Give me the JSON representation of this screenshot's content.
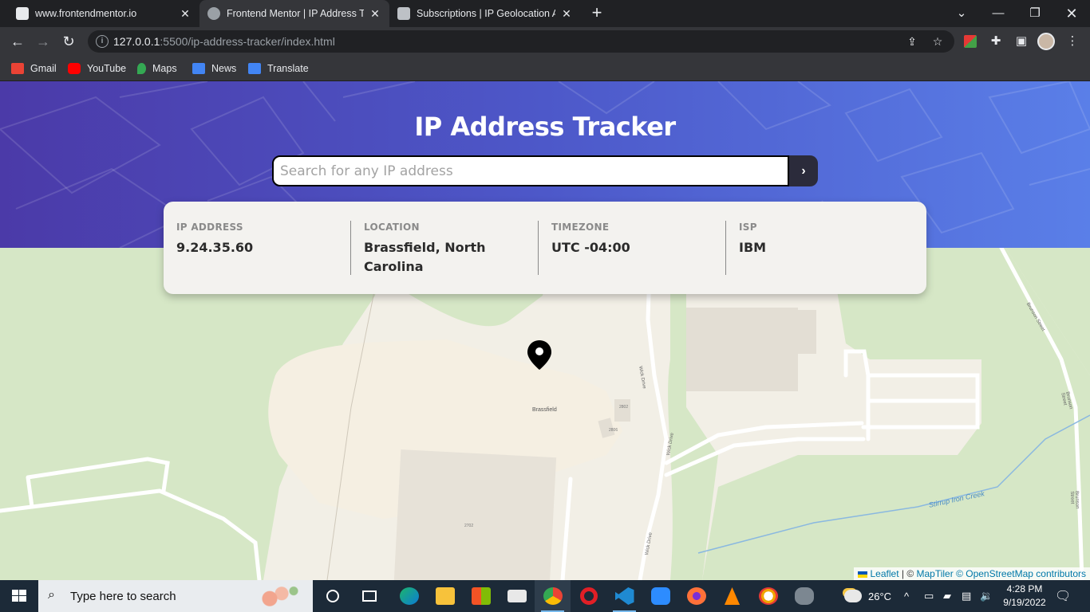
{
  "browser": {
    "tabs": [
      {
        "title": "www.frontendmentor.io",
        "active": false
      },
      {
        "title": "Frontend Mentor | IP Address Tracker",
        "active": true
      },
      {
        "title": "Subscriptions | IP Geolocation API",
        "active": false
      }
    ],
    "url_host": "127.0.0.1",
    "url_rest": ":5500/ip-address-tracker/index.html",
    "bookmarks": [
      "Gmail",
      "YouTube",
      "Maps",
      "News",
      "Translate"
    ]
  },
  "app": {
    "title": "IP Address Tracker",
    "search_placeholder": "Search for any IP address",
    "search_value": "",
    "info": [
      {
        "label": "IP ADDRESS",
        "value": "9.24.35.60"
      },
      {
        "label": "LOCATION",
        "value": "Brassfield, North Carolina"
      },
      {
        "label": "TIMEZONE",
        "value": "UTC -04:00"
      },
      {
        "label": "ISP",
        "value": "IBM"
      }
    ]
  },
  "map": {
    "place_label": "Brassfield",
    "streets": [
      "Wick Drive",
      "Wick Drive",
      "Wick Drive",
      "Brunson Street",
      "Brunson Street",
      "Brunson Street"
    ],
    "creek": "Stirrup Iron Creek",
    "house_numbers": [
      "2802",
      "2806",
      "2702"
    ],
    "attribution": {
      "leaflet": "Leaflet",
      "sep": " | © ",
      "maptiler": "MapTiler",
      "osm": " © OpenStreetMap contributors"
    }
  },
  "taskbar": {
    "search_placeholder": "Type here to search",
    "weather": "26°C",
    "time": "4:28 PM",
    "date": "9/19/2022"
  },
  "colors": {
    "hero_start": "#4b3aa8",
    "hero_end": "#5a7fe8",
    "button_dark": "#2b2b3b",
    "map_land": "#f2efe6",
    "map_green": "#d8e8c8",
    "creek": "#8ab8e0"
  }
}
